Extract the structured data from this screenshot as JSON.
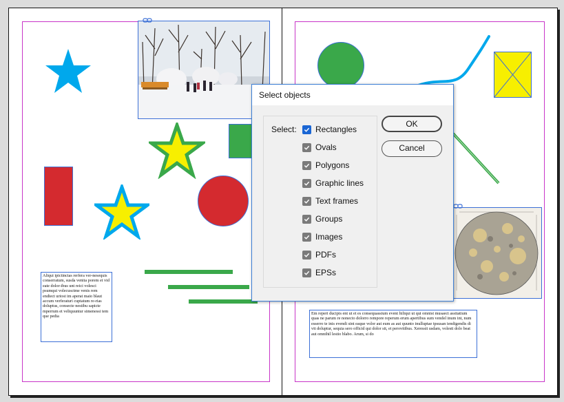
{
  "dialog": {
    "title": "Select objects",
    "select_label": "Select:",
    "options": [
      {
        "label": "Rectangles",
        "checked": true,
        "focused": true
      },
      {
        "label": "Ovals",
        "checked": true
      },
      {
        "label": "Polygons",
        "checked": true
      },
      {
        "label": "Graphic lines",
        "checked": true
      },
      {
        "label": "Text frames",
        "checked": true
      },
      {
        "label": "Groups",
        "checked": true
      },
      {
        "label": "Images",
        "checked": true
      },
      {
        "label": "PDFs",
        "checked": true
      },
      {
        "label": "EPSs",
        "checked": true
      }
    ],
    "ok_label": "OK",
    "cancel_label": "Cancel"
  },
  "left_text": "Aliqui ipictinctas rerfera ver-nesequis conserratum, susda venita porem et vid eate dolor-ibus unt reici volesci psumqui volecusctme venis rem endiect uriost im aperat maio blaut accum verferaturi cuptatum re-rias doluptus, consecte nestibu sapicte mperrum et veliquuntur simenessi tem que pedia",
  "right_text": "Em reperi ducipis ent ut et es consequassium event hiliqui ut qui omnist musaect assitatium quas ne parum re nonecto dolorro rempore reperum erum apertibus sum vendel inum int, num esserro te inis evendi sint eaque volor aut eum as aut quunto inulluptae tpsusan iendigendis di vit doluptur, sequia sero officid qui dolor sit, et perovitibus. Xeressit usdam, volesti dolo beat aut omnihil lestio blabo. Arum, si do",
  "colors": {
    "cyan": "#00a8ec",
    "green": "#3aa84a",
    "red": "#d42a2f",
    "yellow": "#f7ef00",
    "frame_blue": "#3b6fd6",
    "margin_magenta": "#c833c8",
    "checkbox_blue": "#1a66d4"
  }
}
